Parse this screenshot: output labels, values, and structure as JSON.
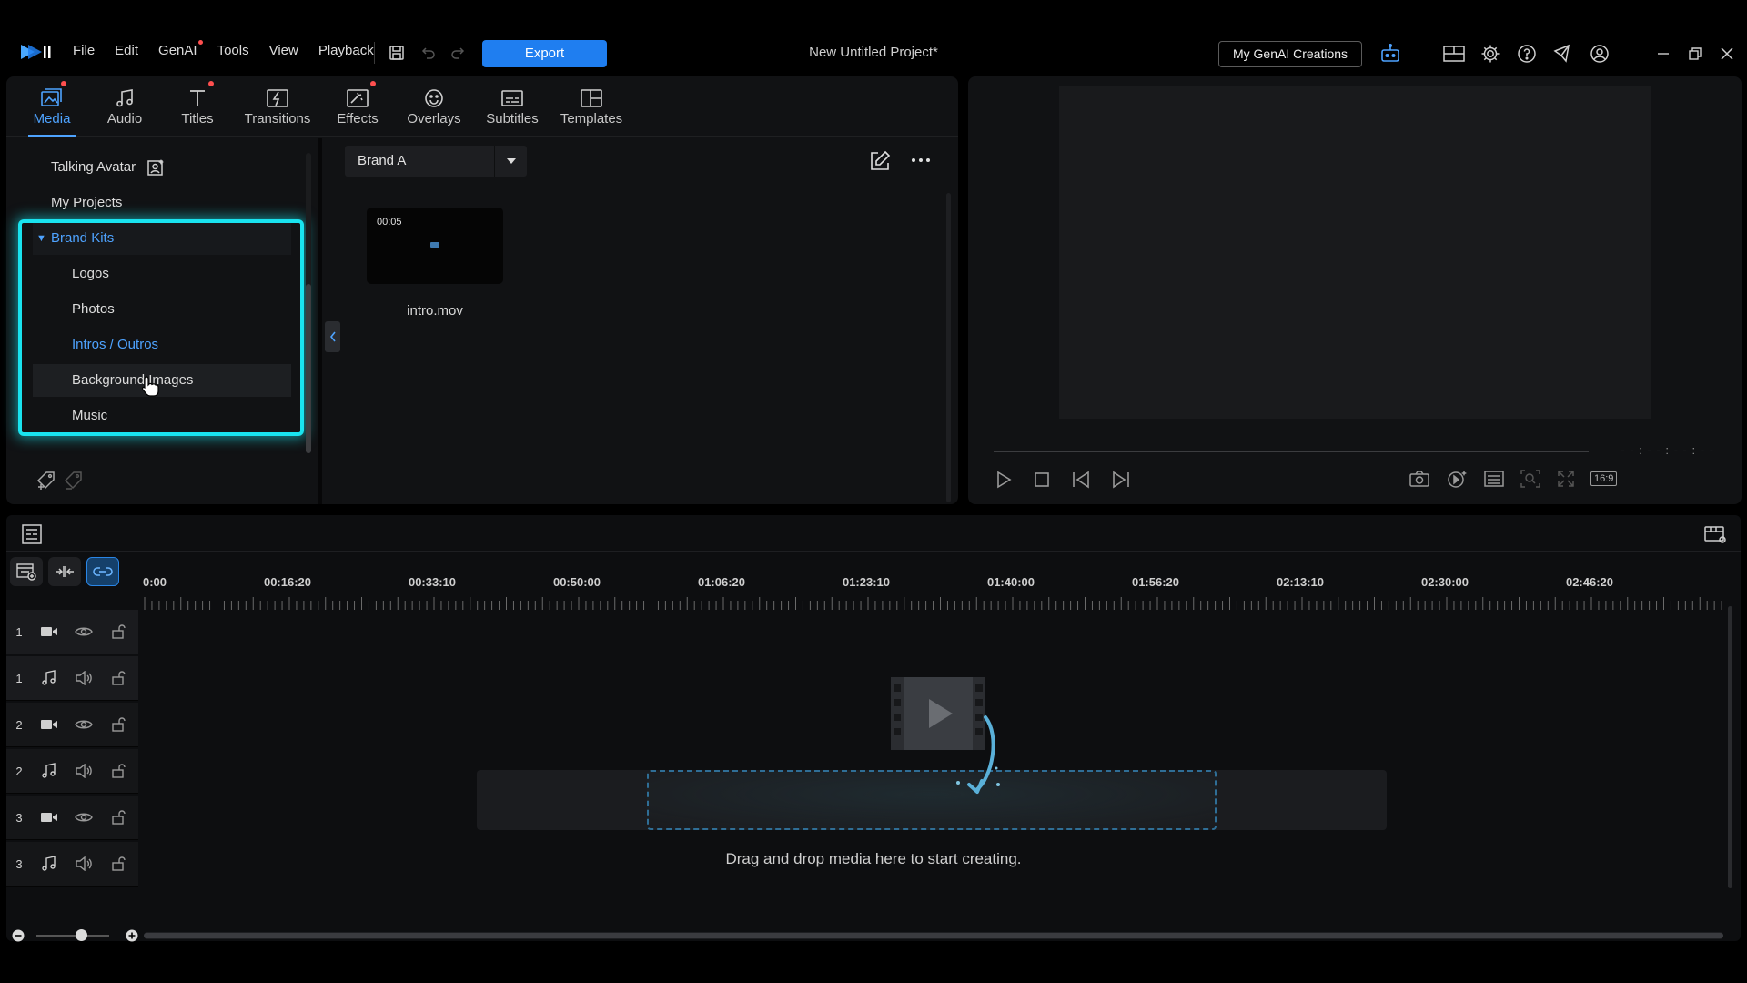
{
  "titlebar": {
    "menus": [
      "File",
      "Edit",
      "GenAI",
      "Tools",
      "View",
      "Playback"
    ],
    "export_label": "Export",
    "project_title": "New Untitled Project*",
    "genai_creations_label": "My GenAI Creations"
  },
  "tabs": [
    {
      "label": "Media",
      "icon": "media-icon",
      "active": true,
      "dot": true
    },
    {
      "label": "Audio",
      "icon": "audio-icon",
      "active": false,
      "dot": false
    },
    {
      "label": "Titles",
      "icon": "titles-icon",
      "active": false,
      "dot": true
    },
    {
      "label": "Transitions",
      "icon": "transitions-icon",
      "active": false,
      "dot": false
    },
    {
      "label": "Effects",
      "icon": "effects-icon",
      "active": false,
      "dot": true
    },
    {
      "label": "Overlays",
      "icon": "overlays-icon",
      "active": false,
      "dot": false
    },
    {
      "label": "Subtitles",
      "icon": "subtitles-icon",
      "active": false,
      "dot": false
    },
    {
      "label": "Templates",
      "icon": "templates-icon",
      "active": false,
      "dot": false
    }
  ],
  "tree": {
    "talking_avatar": "Talking Avatar",
    "my_projects": "My Projects",
    "brand_kits": "Brand Kits",
    "children": [
      "Logos",
      "Photos",
      "Intros / Outros",
      "Background Images",
      "Music"
    ],
    "selected": "Intros / Outros"
  },
  "library": {
    "dropdown_value": "Brand A",
    "clips": [
      {
        "name": "intro.mov",
        "duration": "00:05"
      }
    ]
  },
  "preview": {
    "timecode": "- - : - - : - - : - -",
    "aspect_ratio": "16:9"
  },
  "timeline": {
    "ruler": [
      "0:00",
      "00:16:20",
      "00:33:10",
      "00:50:00",
      "01:06:20",
      "01:23:10",
      "01:40:00",
      "01:56:20",
      "02:13:10",
      "02:30:00",
      "02:46:20"
    ],
    "tracks": [
      {
        "num": "1",
        "type": "video"
      },
      {
        "num": "1",
        "type": "audio"
      },
      {
        "num": "2",
        "type": "video"
      },
      {
        "num": "2",
        "type": "audio"
      },
      {
        "num": "3",
        "type": "video"
      },
      {
        "num": "3",
        "type": "audio"
      }
    ],
    "drop_message": "Drag and drop media here to start creating."
  },
  "colors": {
    "accent": "#1f7ef0",
    "active_tab": "#4ea3ff",
    "highlight": "#19e3ef"
  }
}
